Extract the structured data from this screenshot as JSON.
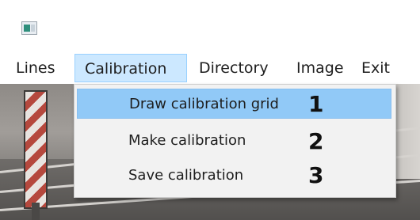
{
  "window": {
    "icon": "app-window-icon"
  },
  "menubar": {
    "items": [
      {
        "label": "Lines"
      },
      {
        "label": "Calibration"
      },
      {
        "label": "Directory"
      },
      {
        "label": "Image"
      },
      {
        "label": "Exit"
      }
    ],
    "active_index": 1
  },
  "calibration_menu": {
    "items": [
      {
        "label": "Draw calibration grid",
        "annotation": "1",
        "highlighted": true
      },
      {
        "label": "Make calibration",
        "annotation": "2",
        "highlighted": false
      },
      {
        "label": "Save calibration",
        "annotation": "3",
        "highlighted": false
      }
    ]
  },
  "colors": {
    "menu_active_bg": "#cce8ff",
    "menu_item_highlight": "#91c9f7",
    "dropdown_bg": "#f2f2f2"
  }
}
